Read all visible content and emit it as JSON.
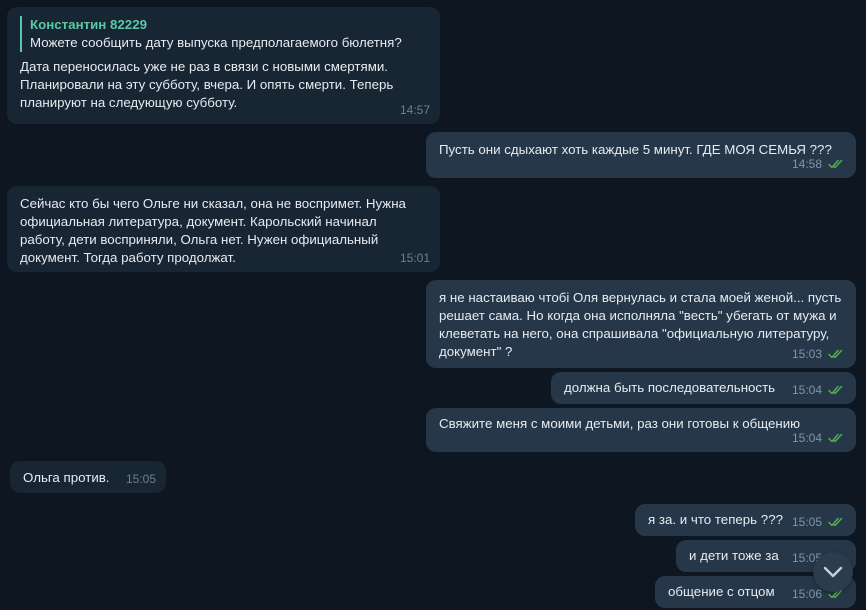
{
  "colors": {
    "background": "#0e1621",
    "incoming_bubble": "#182533",
    "outgoing_bubble": "#26374a",
    "reply_accent": "#5bc8a5",
    "read_check": "#4fae4e"
  },
  "messages": [
    {
      "id": "m1",
      "direction": "incoming",
      "reply": {
        "name": "Константин 82229",
        "text": "Можете сообщить дату выпуска предполагаемого бюлетня?"
      },
      "text": "Дата переносилась уже не раз в связи с новыми смертями.\nПланировали на эту субботу, вчера. И опять смерти. Теперь\nпланируют на следующую субботу.",
      "time": "14:57"
    },
    {
      "id": "m2",
      "direction": "outgoing",
      "text": "Пусть они сдыхают хоть каждые 5 минут. ГДЕ МОЯ СЕМЬЯ ???",
      "time": "14:58",
      "status_icon": "double-check-icon"
    },
    {
      "id": "m3",
      "direction": "incoming",
      "text": "Сейчас кто бы чего Ольге ни сказал, она не воспримет. Нужна\nофициальная литература, документ. Карольский начинал\nработу, дети восприняли, Ольга нет. Нужен официальный\nдокумент. Тогда работу продолжат.",
      "time": "15:01"
    },
    {
      "id": "m4",
      "direction": "outgoing",
      "text": "я не настаиваю чтобі Оля вернулась и стала моей женой... пусть\nрешает сама. Но когда она исполняла \"весть\"  убегать от мужа и\nклеветать на него, она спрашивала \"официальную литературу,\nдокумент\" ?",
      "time": "15:03",
      "status_icon": "double-check-icon"
    },
    {
      "id": "m5",
      "direction": "outgoing",
      "text": "должна быть последовательность",
      "time": "15:04",
      "status_icon": "double-check-icon"
    },
    {
      "id": "m6",
      "direction": "outgoing",
      "text": "Свяжите меня с моими детьми, раз они готовы к общению",
      "time": "15:04",
      "status_icon": "double-check-icon"
    },
    {
      "id": "m7",
      "direction": "incoming",
      "text": "Ольга против.",
      "time": "15:05"
    },
    {
      "id": "m8",
      "direction": "outgoing",
      "text": "я за. и что теперь ???",
      "time": "15:05",
      "status_icon": "double-check-icon"
    },
    {
      "id": "m9",
      "direction": "outgoing",
      "text": "и дети тоже за",
      "time": "15:05",
      "status_icon": "double-check-icon"
    },
    {
      "id": "m10",
      "direction": "outgoing",
      "text": "общение с отцом",
      "time": "15:06",
      "status_icon": "double-check-icon"
    }
  ],
  "scroll_button": {
    "icon": "chevron-down-icon"
  }
}
